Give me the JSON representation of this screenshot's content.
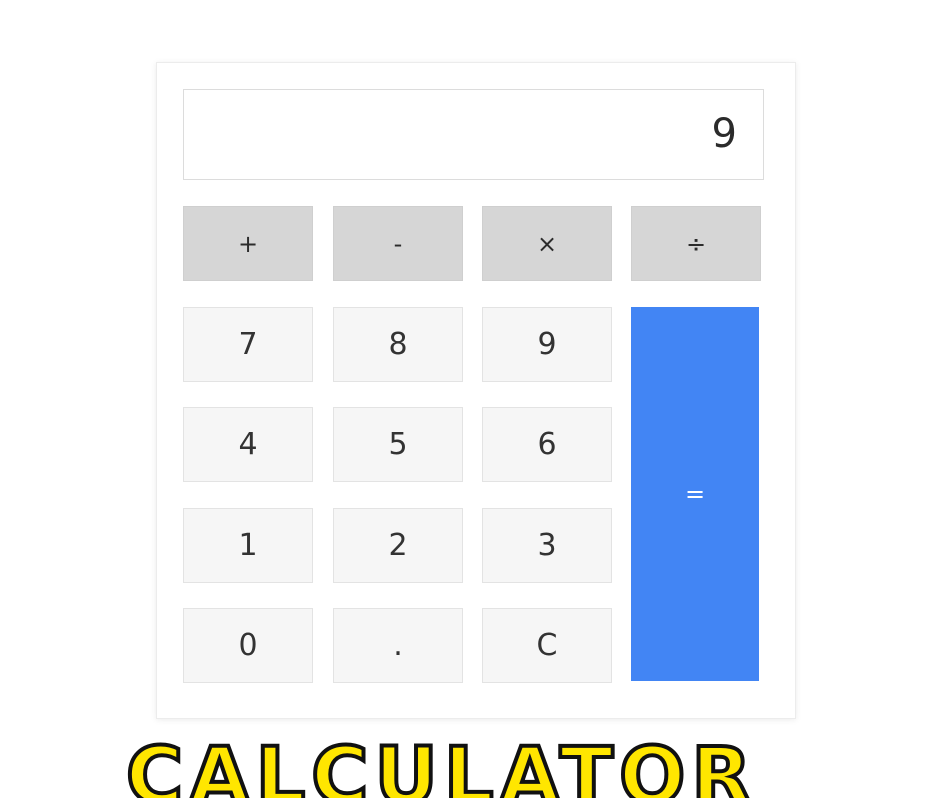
{
  "display": {
    "value": "9"
  },
  "operators": [
    {
      "label": "+"
    },
    {
      "label": "-"
    },
    {
      "label": "×"
    },
    {
      "label": "÷"
    }
  ],
  "keys": {
    "seven": "7",
    "eight": "8",
    "nine": "9",
    "four": "4",
    "five": "5",
    "six": "6",
    "one": "1",
    "two": "2",
    "three": "3",
    "zero": "0",
    "decimal": ".",
    "clear": "C"
  },
  "equals": {
    "label": "="
  },
  "banner": {
    "text": "CALCULATOR"
  },
  "colors": {
    "equals_bg": "#4285f4",
    "operator_bg": "#d6d6d6",
    "key_bg": "#f6f6f6",
    "banner_fill": "#ffe600"
  }
}
